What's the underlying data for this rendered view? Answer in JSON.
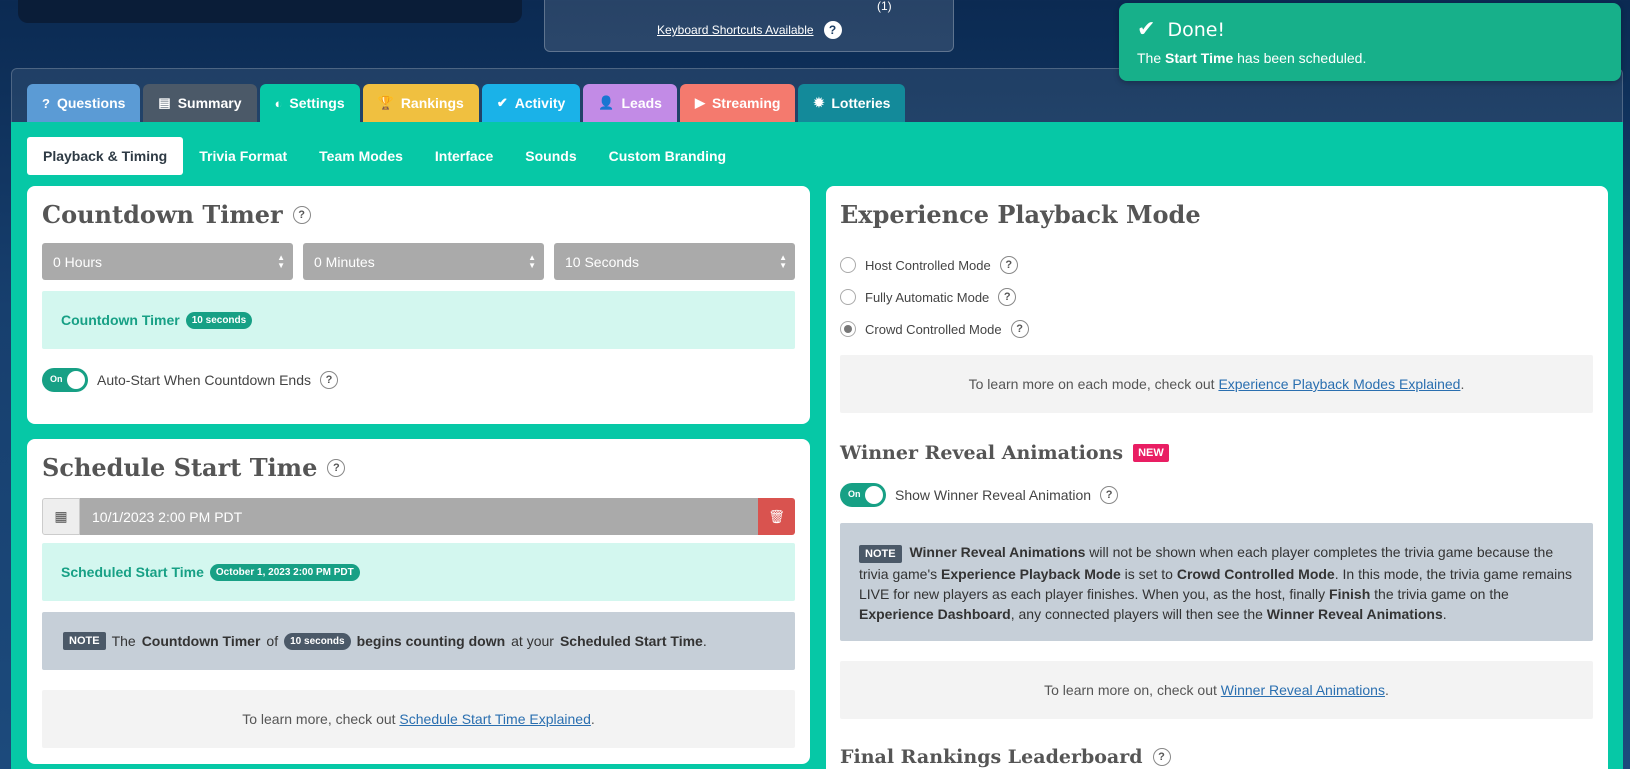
{
  "top_bar": {
    "paren_text": "(1)",
    "keyboard_shortcuts_label": "Keyboard Shortcuts Available",
    "help_glyph": "?"
  },
  "toast": {
    "title": "Done!",
    "message_prefix": "The",
    "message_bold": "Start Time",
    "message_suffix": "has been scheduled.",
    "color": "#17b08a"
  },
  "tabs": [
    {
      "label": "Questions",
      "icon": "question-icon",
      "color": "#5b9bd5"
    },
    {
      "label": "Summary",
      "icon": "list-icon",
      "color": "#4b5968"
    },
    {
      "label": "Settings",
      "icon": "toggle-icon",
      "color": "#06c8a6"
    },
    {
      "label": "Rankings",
      "icon": "trophy-icon",
      "color": "#f0c040"
    },
    {
      "label": "Activity",
      "icon": "check-circle-icon",
      "color": "#1ab2e8"
    },
    {
      "label": "Leads",
      "icon": "user-icon",
      "color": "#c28be6"
    },
    {
      "label": "Streaming",
      "icon": "video-icon",
      "color": "#f47a6e"
    },
    {
      "label": "Lotteries",
      "icon": "gear-icon",
      "color": "#138a9a"
    }
  ],
  "subtabs": [
    "Playback & Timing",
    "Trivia Format",
    "Team Modes",
    "Interface",
    "Sounds",
    "Custom Branding"
  ],
  "countdown": {
    "title": "Countdown Timer",
    "hours": "0 Hours",
    "minutes": "0 Minutes",
    "seconds": "10 Seconds",
    "summary_label": "Countdown Timer",
    "summary_value": "10 seconds",
    "toggle_state": "On",
    "auto_start_label": "Auto-Start When Countdown Ends"
  },
  "schedule": {
    "title": "Schedule Start Time",
    "date_value": "10/1/2023 2:00 PM PDT",
    "summary_label": "Scheduled Start Time",
    "summary_value": "October 1, 2023 2:00 PM PDT",
    "note_badge": "NOTE",
    "note_the": "The",
    "note_countdown": "Countdown Timer",
    "note_of": "of",
    "note_seconds": "10 seconds",
    "note_begins": "begins counting down",
    "note_at": "at your",
    "note_scheduled": "Scheduled Start Time",
    "note_end": ".",
    "learn_prefix": "To learn more, check out",
    "learn_link": "Schedule Start Time Explained",
    "learn_suffix": "."
  },
  "playback": {
    "title": "Experience Playback Mode",
    "modes": [
      {
        "label": "Host Controlled Mode",
        "selected": false
      },
      {
        "label": "Fully Automatic Mode",
        "selected": false
      },
      {
        "label": "Crowd Controlled Mode",
        "selected": true
      }
    ],
    "learn_prefix": "To learn more on each mode, check out",
    "learn_link": "Experience Playback Modes Explained",
    "learn_suffix": "."
  },
  "winner": {
    "title": "Winner Reveal Animations",
    "new_badge": "NEW",
    "toggle_state": "On",
    "toggle_label": "Show Winner Reveal Animation",
    "note_badge": "NOTE",
    "note_parts": [
      {
        "t": "Winner Reveal Animations",
        "b": true
      },
      {
        "t": " will not be shown when each player completes the trivia game because the trivia game's ",
        "b": false
      },
      {
        "t": "Experience Playback Mode",
        "b": true
      },
      {
        "t": " is set to ",
        "b": false
      },
      {
        "t": "Crowd Controlled Mode",
        "b": true
      },
      {
        "t": ". In this mode, the trivia game remains LIVE for new players as each player finishes. When you, as the host, finally ",
        "b": false
      },
      {
        "t": "Finish",
        "b": true
      },
      {
        "t": " the trivia game on the ",
        "b": false
      },
      {
        "t": "Experience Dashboard",
        "b": true
      },
      {
        "t": ", any connected players will then see the ",
        "b": false
      },
      {
        "t": "Winner Reveal Animations",
        "b": true
      },
      {
        "t": ".",
        "b": false
      }
    ],
    "learn_prefix": "To learn more on, check out",
    "learn_link": "Winner Reveal Animations",
    "learn_suffix": "."
  },
  "leaderboard": {
    "title": "Final Rankings Leaderboard"
  }
}
